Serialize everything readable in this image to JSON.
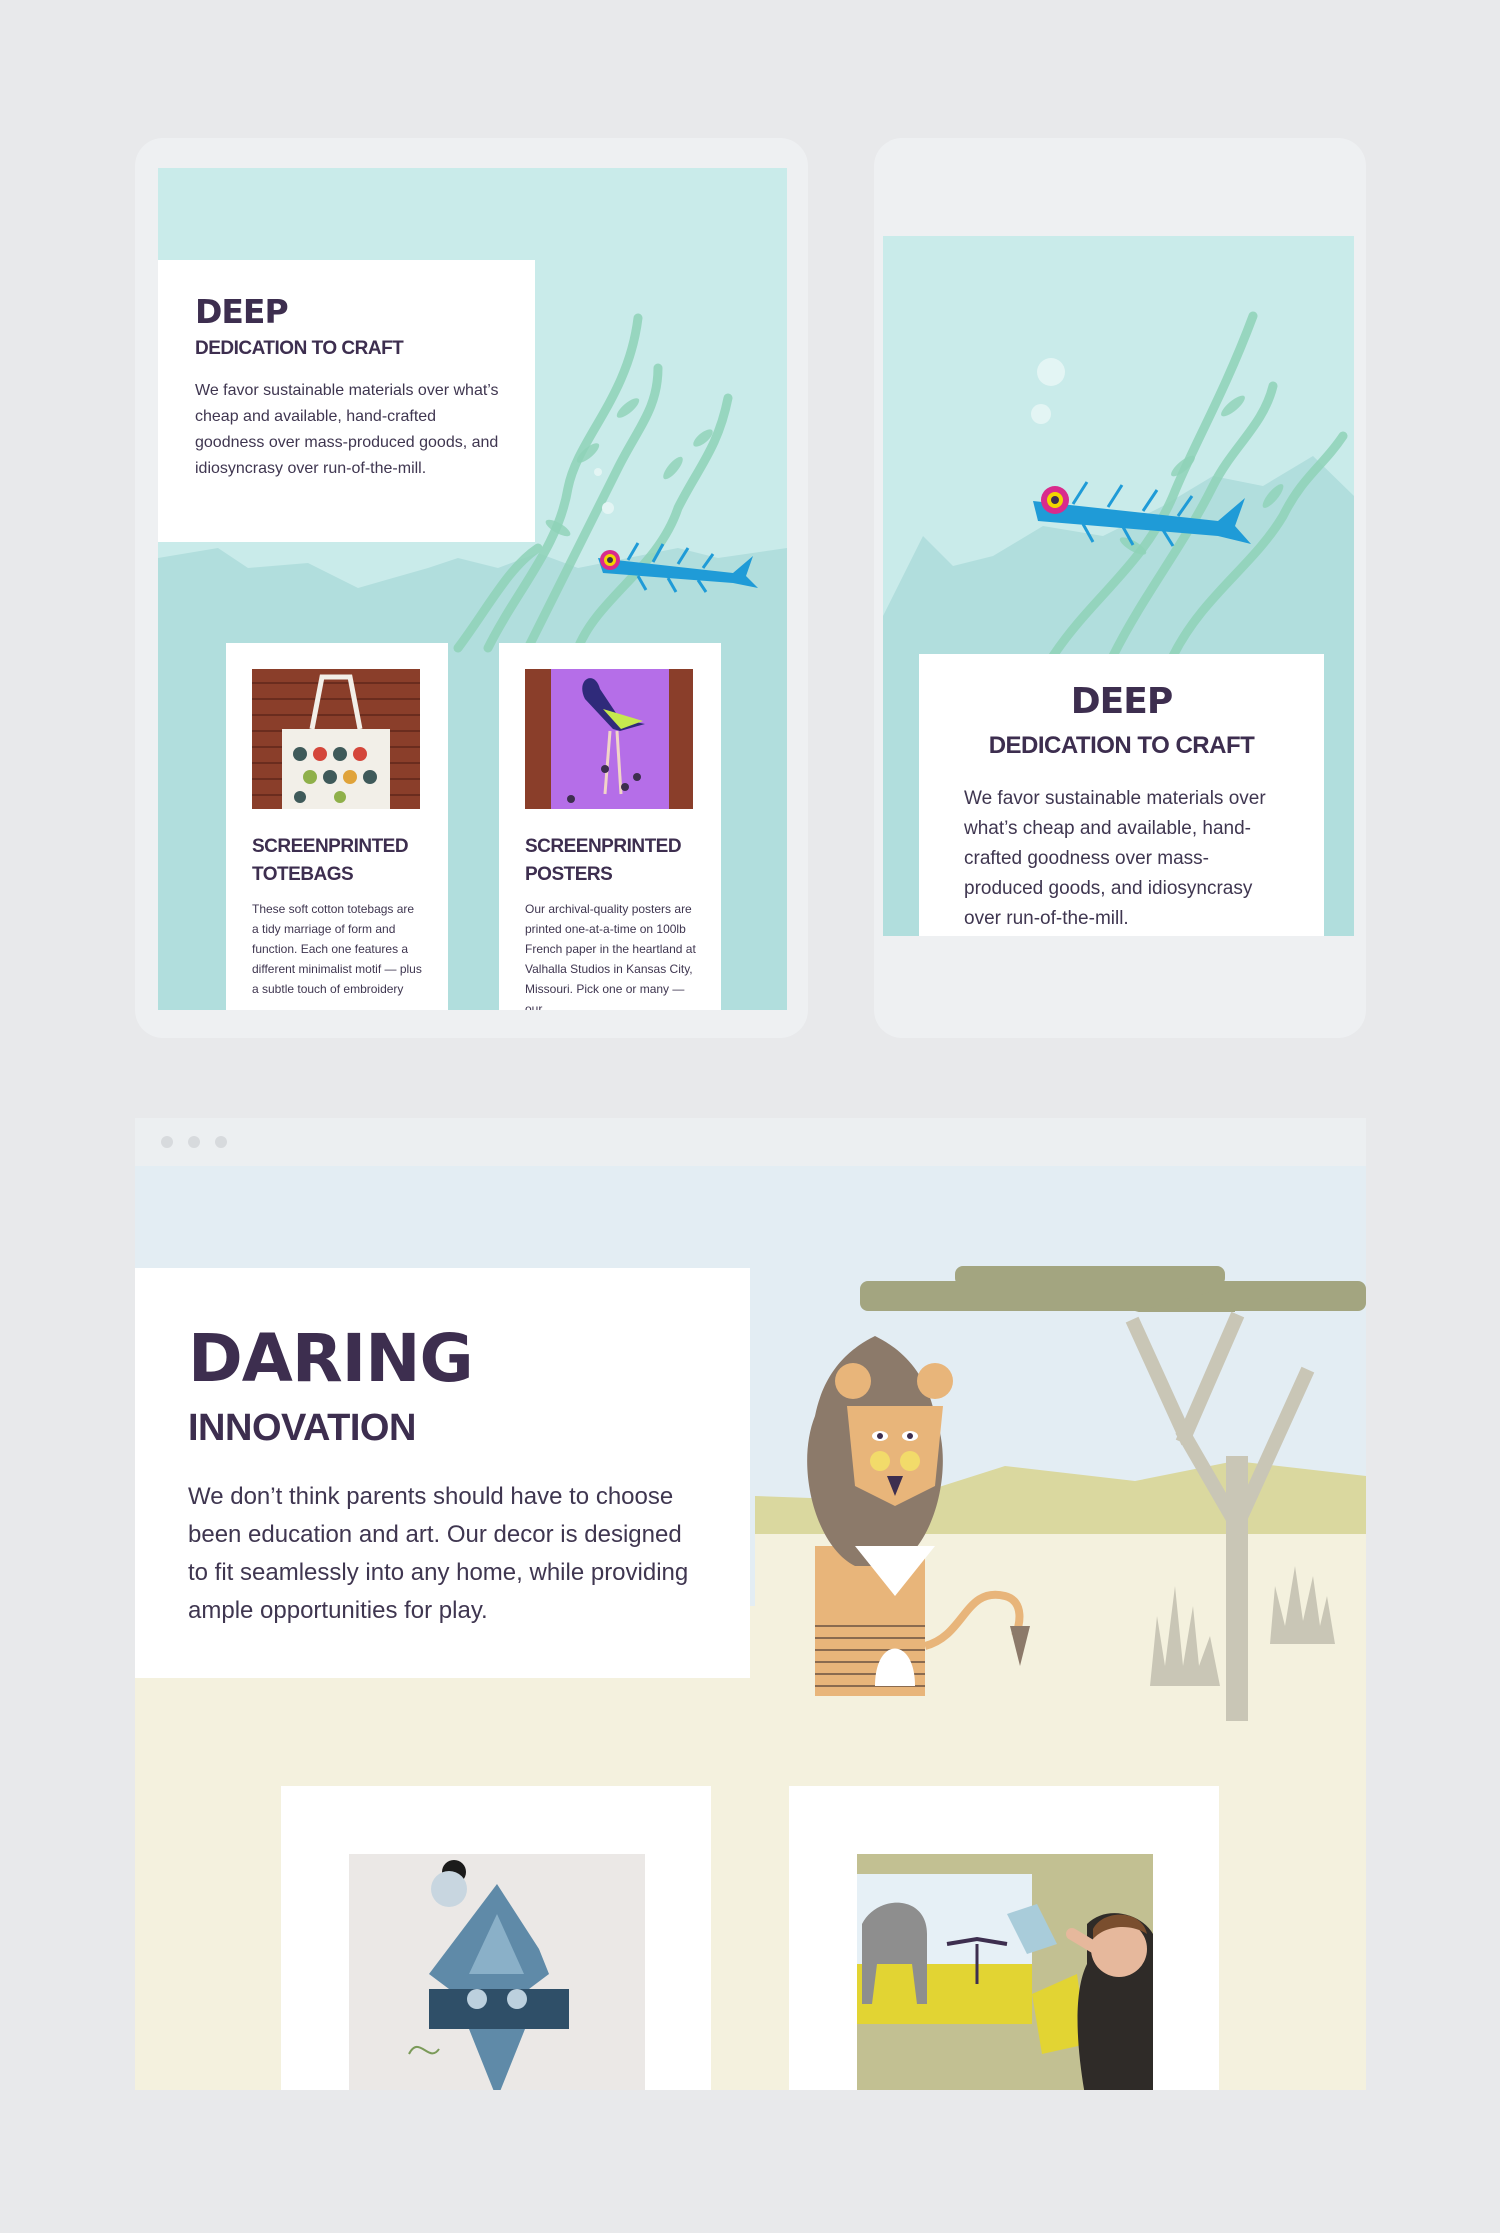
{
  "tablet": {
    "hero": {
      "title": "DEEP",
      "subtitle": "DEDICATION TO CRAFT",
      "body": "We favor sustainable materials over what’s cheap and available, hand-crafted goodness over mass-produced goods, and idiosyncrasy over run-of-the-mill."
    },
    "products": [
      {
        "title_line1": "SCREENPRINTED",
        "title_line2": "TOTEBAGS",
        "body": "These soft cotton totebags are a tidy marriage of form and function. Each one features a different minimalist motif — plus a subtle touch of embroidery"
      },
      {
        "title_line1": "SCREENPRINTED",
        "title_line2": "POSTERS",
        "body": "Our archival-quality posters are printed one-at-a-time on 100lb French paper in the heartland at Valhalla Studios in Kansas City, Missouri. Pick one or many — our"
      }
    ]
  },
  "phone": {
    "hero": {
      "title": "DEEP",
      "subtitle": "DEDICATION TO CRAFT",
      "body": "We favor sustainable materials over what’s cheap and available, hand-crafted goodness over mass-produced goods, and idiosyncrasy over run-of-the-mill."
    }
  },
  "browser": {
    "hero": {
      "title": "DARING",
      "subtitle": "INNOVATION",
      "body": "We don’t think parents should have to choose been education and art. Our decor is designed to fit seamlessly into any home, while providing ample opportunities for play."
    }
  },
  "colors": {
    "ink": "#3d2e4f",
    "ocean": "#c9ebea",
    "sky": "#e3edf3",
    "sand": "#f4f1de",
    "fish": "#1f9bd7"
  }
}
